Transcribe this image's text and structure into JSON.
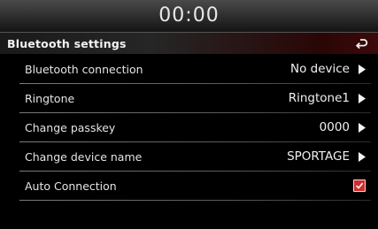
{
  "status_bar": {
    "time": "00:00"
  },
  "header": {
    "title": "Bluetooth settings",
    "back_icon": "back-arrow-icon"
  },
  "settings": [
    {
      "label": "Bluetooth connection",
      "value": "No device",
      "control": "chevron-right-icon"
    },
    {
      "label": "Ringtone",
      "value": "Ringtone1",
      "control": "chevron-right-icon"
    },
    {
      "label": "Change passkey",
      "value": "0000",
      "control": "chevron-right-icon"
    },
    {
      "label": "Change device name",
      "value": "SPORTAGE",
      "control": "chevron-right-icon"
    },
    {
      "label": "Auto Connection",
      "checked": true,
      "control": "checkbox"
    }
  ],
  "colors": {
    "accent": "#d02c2c",
    "text": "#e4e4e4",
    "background": "#000000"
  }
}
